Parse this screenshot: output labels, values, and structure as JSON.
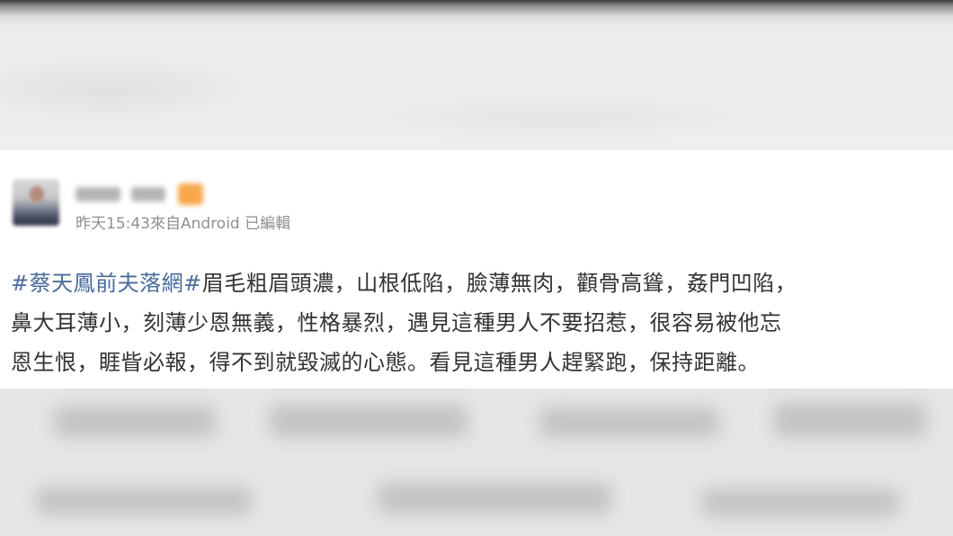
{
  "post": {
    "meta": {
      "time": "昨天15:43",
      "source": "來自Android",
      "edited": "已編輯"
    },
    "text": {
      "hashtag": "#蔡天鳳前夫落網#",
      "line1_rest": "眉毛粗眉頭濃，山根低陷，臉薄無肉，顴骨高聳，姦門凹陷，",
      "line2": "鼻大耳薄小，刻薄少恩無義，性格暴烈，遇見這種男人不要招惹，很容易被他忘",
      "line3": "恩生恨，睚眥必報，得不到就毀滅的心態。看見這種男人趕緊跑，保持距離。"
    }
  },
  "colors": {
    "hashtag": "#4a6b9b",
    "body_text": "#333333",
    "meta_text": "#8f8f8f",
    "vip_badge": "#f6a84a"
  },
  "icons": {
    "avatar": "user-avatar-blurred",
    "badge": "vip-badge-icon"
  }
}
